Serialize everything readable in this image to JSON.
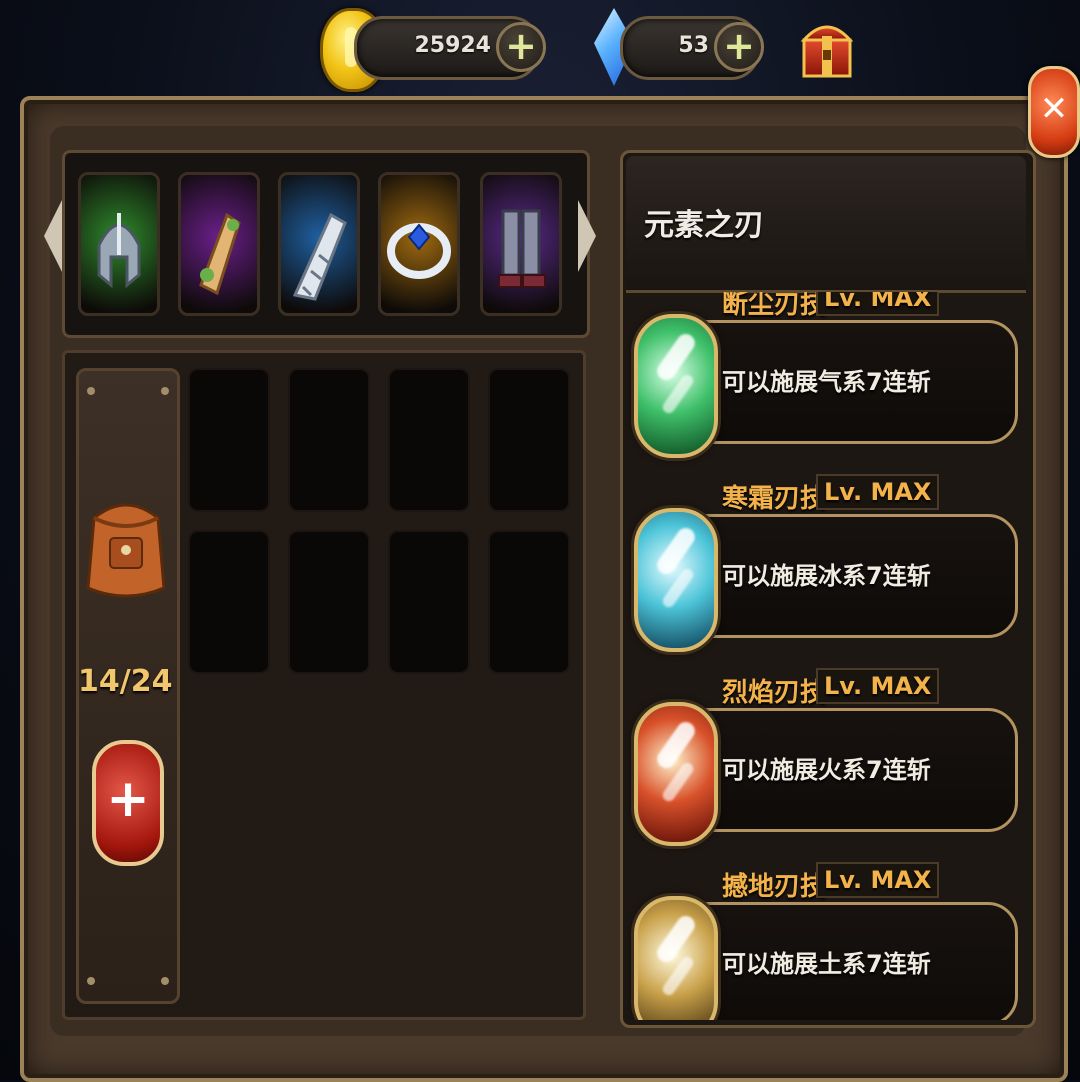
{
  "currency": {
    "gold": {
      "value": "25924",
      "icon": "gold-coin-icon"
    },
    "gems": {
      "value": "53",
      "icon": "blue-crystal-icon"
    },
    "shop_icon": "treasure-chest-icon"
  },
  "close_icon": "close-x-icon",
  "equipment": [
    {
      "icon": "helmet-icon",
      "bg": "#2f8a2c"
    },
    {
      "icon": "scroll-pouch-icon",
      "bg": "#6a1f8a"
    },
    {
      "icon": "gauntlet-icon",
      "bg": "#1f5fa0"
    },
    {
      "icon": "ring-icon",
      "bg": "#a06a10"
    },
    {
      "icon": "boots-icon",
      "bg": "#5a2a8a"
    }
  ],
  "bag": {
    "icon": "backpack-icon",
    "count": "14/24",
    "add_icon": "plus-icon"
  },
  "skills_panel": {
    "title": "元素之刃",
    "skills": [
      {
        "name": "断尘刃技",
        "level": "Lv. MAX",
        "desc": "可以施展气系7连斩",
        "colors": [
          "#d8ffe6",
          "#3fc06a",
          "#0c4a20"
        ]
      },
      {
        "name": "寒霜刃技",
        "level": "Lv. MAX",
        "desc": "可以施展冰系7连斩",
        "colors": [
          "#e6fbff",
          "#4cc4d8",
          "#0c3c52"
        ]
      },
      {
        "name": "烈焰刃技",
        "level": "Lv. MAX",
        "desc": "可以施展火系7连斩",
        "colors": [
          "#fff2cc",
          "#d8512a",
          "#5a0c06"
        ]
      },
      {
        "name": "撼地刃技",
        "level": "Lv. MAX",
        "desc": "可以施展土系7连斩",
        "colors": [
          "#fffbe0",
          "#c9a14a",
          "#3f2c0c"
        ]
      }
    ]
  }
}
